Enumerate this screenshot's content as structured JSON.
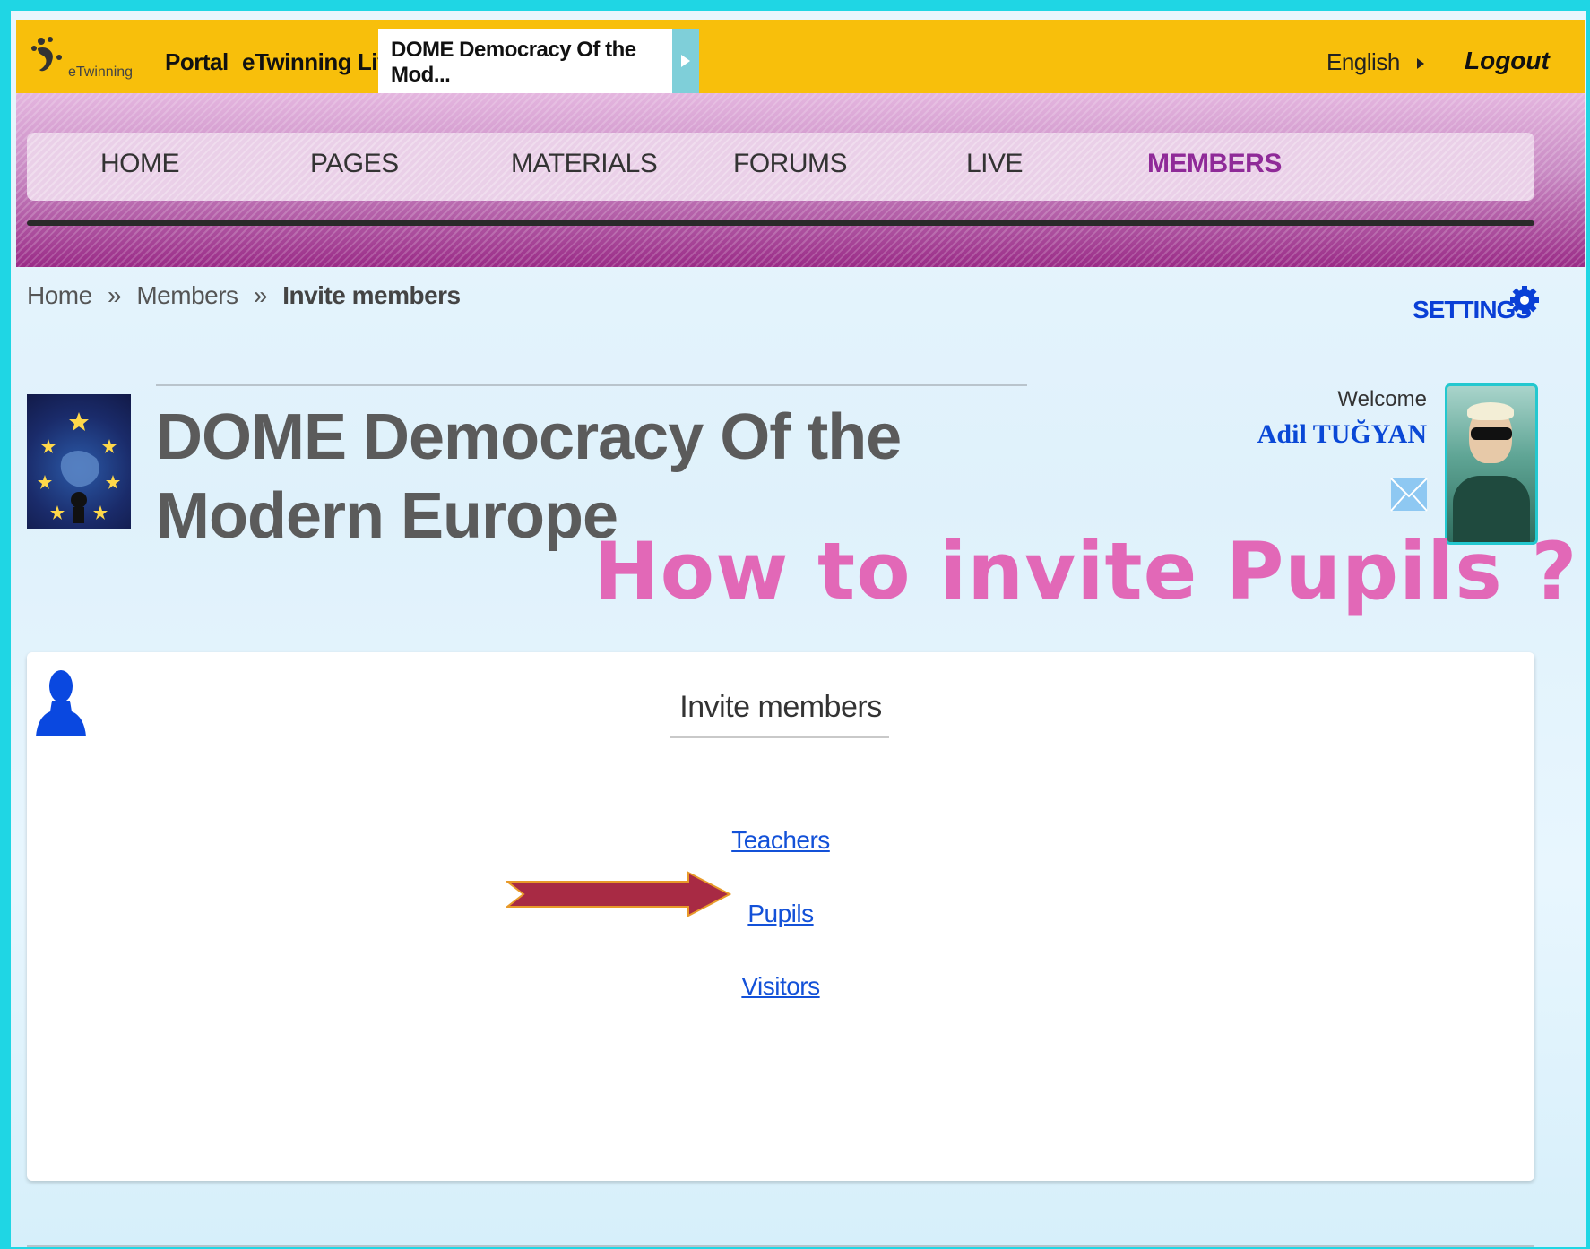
{
  "topbar": {
    "logo_text": "eTwinning",
    "portal": "Portal",
    "live": "eTwinning Live",
    "active_tab": "DOME Democracy Of the Mod...",
    "language": "English",
    "logout": "Logout"
  },
  "nav": {
    "items": [
      "HOME",
      "PAGES",
      "MATERIALS",
      "FORUMS",
      "LIVE",
      "MEMBERS"
    ],
    "active": "MEMBERS"
  },
  "breadcrumb": [
    "Home",
    "Members",
    "Invite members"
  ],
  "breadcrumb_separator": "»",
  "settings": "SETTINGS",
  "project": {
    "title": "DOME Democracy Of the Modern Europe"
  },
  "user": {
    "welcome": "Welcome",
    "name": "Adil TUĞYAN"
  },
  "annotation": "How to invite Pupils ?",
  "panel": {
    "title": "Invite members",
    "links": [
      "Teachers",
      "Pupils",
      "Visitors"
    ]
  },
  "colors": {
    "topbar": "#f8bf0b",
    "accent_purple": "#8f2a98",
    "link_blue": "#1351d8",
    "annotation_pink": "#e268b7",
    "arrow_red": "#a82a44",
    "frame_cyan": "#1fd6e4"
  },
  "icons": [
    "etwinning-logo-icon",
    "play-arrow-icon",
    "chevron-right-icon",
    "gear-icon",
    "mail-icon",
    "person-silhouette-icon",
    "arrow-pointer-icon"
  ]
}
